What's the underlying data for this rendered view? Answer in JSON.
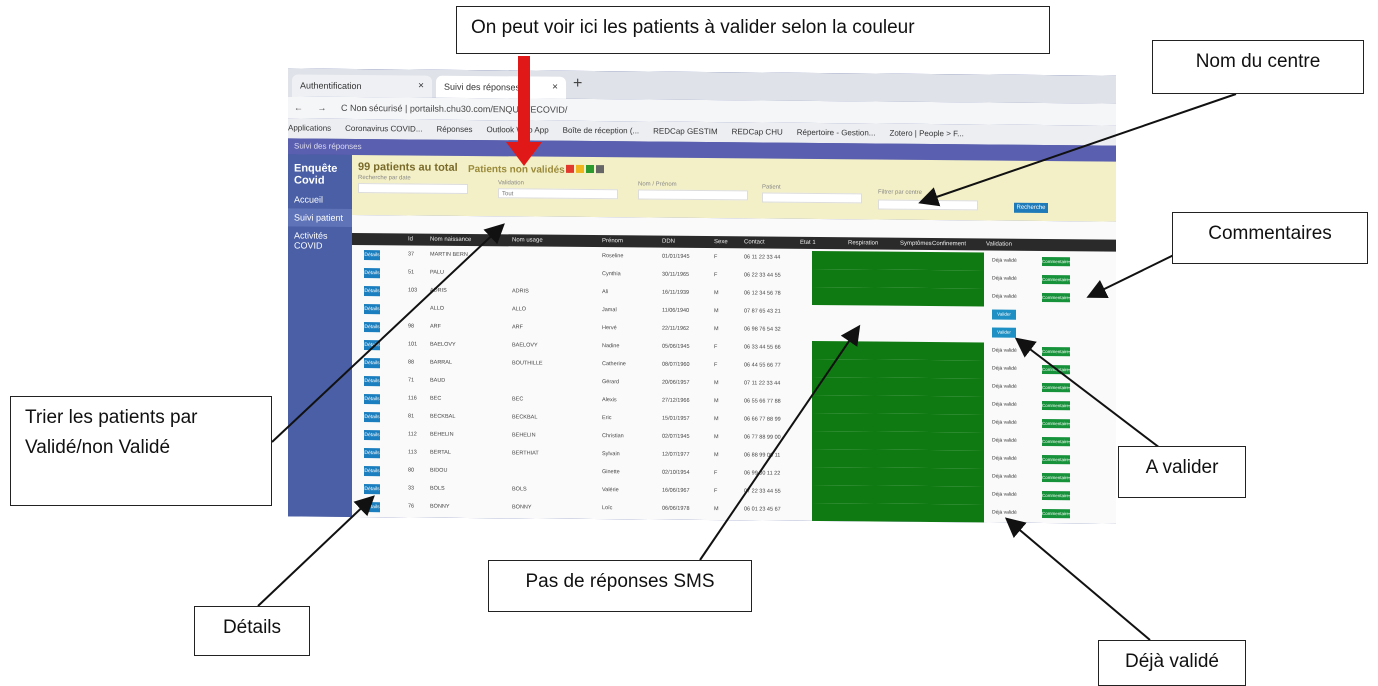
{
  "callouts": {
    "patients_couleur": "On peut voir ici les patients à valider selon la couleur",
    "nom_centre": "Nom du centre",
    "commentaires": "Commentaires",
    "trier_line1": "Trier les patients par",
    "trier_line2": "Validé/non Validé",
    "a_valider": "A valider",
    "pas_sms": "Pas de réponses SMS",
    "details": "Détails",
    "deja_valide": "Déjà validé"
  },
  "browser": {
    "tab1": "Authentification",
    "tab2": "Suivi des réponses",
    "close": "×",
    "new_tab": "+",
    "nav": "← → C ⌂",
    "url": "Non sécurisé | portailsh.chu30.com/ENQUETECOVID/",
    "bookmarks": [
      "Applications",
      "Coronavirus COVID...",
      "Réponses",
      "Outlook Web App",
      "Boîte de réception (...",
      "REDCap GESTIM",
      "REDCap CHU",
      "Répertoire - Gestion...",
      "Zotero | People > F..."
    ]
  },
  "app": {
    "topbar": "Suivi des réponses",
    "brand": "Enquête Covid",
    "side_items": [
      "Accueil",
      "Suivi patient",
      "Activités COVID"
    ],
    "total": "99 patients au total",
    "non_valides": "Patients non validés :",
    "status_colors": [
      "#e23b2e",
      "#f0b41c",
      "#2c9a2c",
      "#666666"
    ],
    "filter_labels": [
      "Recherche par date",
      "Validation",
      "Nom / Prénom",
      "Patient",
      "Filtrer par centre"
    ],
    "filter_value": "Tout",
    "search_button": "Recherche",
    "columns": [
      "Id",
      "Nom naissance",
      "Nom usage",
      "Prénom",
      "DDN",
      "Sexe",
      "Contact",
      "Etat 1",
      "Respiration",
      "Symptômes",
      "Confinement",
      "Validation"
    ]
  },
  "rows": [
    {
      "id": "37",
      "nom": "MARTIN BERN",
      "usage": "",
      "prenom": "Roseline",
      "ddn": "01/01/1945",
      "sexe": "F",
      "contact": "06 11 22 33 44",
      "green": true,
      "validation": "Déjà validé",
      "comment": true
    },
    {
      "id": "51",
      "nom": "PALU",
      "usage": "",
      "prenom": "Cynthia",
      "ddn": "30/11/1965",
      "sexe": "F",
      "contact": "06 22 33 44 55",
      "green": true,
      "validation": "Déjà validé",
      "comment": true
    },
    {
      "id": "103",
      "nom": "ADRIS",
      "usage": "ADRIS",
      "prenom": "Ali",
      "ddn": "16/11/1939",
      "sexe": "M",
      "contact": "06 12 34 56 78",
      "green": true,
      "validation": "Déjà validé",
      "comment": true
    },
    {
      "id": "",
      "nom": "ALLO",
      "usage": "ALLO",
      "prenom": "Jamal",
      "ddn": "11/06/1940",
      "sexe": "M",
      "contact": "07 87 65 43 21",
      "green": false,
      "validation": "Valider",
      "comment": false
    },
    {
      "id": "98",
      "nom": "ARF",
      "usage": "ARF",
      "prenom": "Hervé",
      "ddn": "22/11/1962",
      "sexe": "M",
      "contact": "06 98 76 54 32",
      "green": false,
      "validation": "Valider",
      "comment": false
    },
    {
      "id": "101",
      "nom": "BAELOVY",
      "usage": "BAELOVY",
      "prenom": "Nadine",
      "ddn": "05/06/1945",
      "sexe": "F",
      "contact": "06 33 44 55 66",
      "green": true,
      "validation": "Déjà validé",
      "comment": true
    },
    {
      "id": "88",
      "nom": "BARRAL",
      "usage": "BOUTHILLE",
      "prenom": "Catherine",
      "ddn": "08/07/1960",
      "sexe": "F",
      "contact": "06 44 55 66 77",
      "green": true,
      "validation": "Déjà validé",
      "comment": true
    },
    {
      "id": "71",
      "nom": "BAUD",
      "usage": "",
      "prenom": "Gérard",
      "ddn": "20/06/1957",
      "sexe": "M",
      "contact": "07 11 22 33 44",
      "green": true,
      "validation": "Déjà validé",
      "comment": true
    },
    {
      "id": "116",
      "nom": "BEC",
      "usage": "BEC",
      "prenom": "Alexis",
      "ddn": "27/12/1966",
      "sexe": "M",
      "contact": "06 55 66 77 88",
      "green": true,
      "validation": "Déjà validé",
      "comment": true
    },
    {
      "id": "81",
      "nom": "BECKBAL",
      "usage": "BECKBAL",
      "prenom": "Eric",
      "ddn": "15/01/1957",
      "sexe": "M",
      "contact": "06 66 77 88 99",
      "green": true,
      "validation": "Déjà validé",
      "comment": true
    },
    {
      "id": "112",
      "nom": "BEHELIN",
      "usage": "BEHELIN",
      "prenom": "Christian",
      "ddn": "02/07/1945",
      "sexe": "M",
      "contact": "06 77 88 99 00",
      "green": true,
      "validation": "Déjà validé",
      "comment": true
    },
    {
      "id": "113",
      "nom": "BERTAL",
      "usage": "BERTHIAT",
      "prenom": "Sylvain",
      "ddn": "12/07/1977",
      "sexe": "M",
      "contact": "06 88 99 00 11",
      "green": true,
      "validation": "Déjà validé",
      "comment": true
    },
    {
      "id": "80",
      "nom": "BIDOU",
      "usage": "",
      "prenom": "Ginette",
      "ddn": "02/10/1954",
      "sexe": "F",
      "contact": "06 99 00 11 22",
      "green": true,
      "validation": "Déjà validé",
      "comment": true
    },
    {
      "id": "33",
      "nom": "BOLS",
      "usage": "BOLS",
      "prenom": "Valérie",
      "ddn": "16/06/1967",
      "sexe": "F",
      "contact": "07 22 33 44 55",
      "green": true,
      "validation": "Déjà validé",
      "comment": true
    },
    {
      "id": "76",
      "nom": "BONNY",
      "usage": "BONNY",
      "prenom": "Loïc",
      "ddn": "06/06/1978",
      "sexe": "M",
      "contact": "06 01 23 45 67",
      "green": true,
      "validation": "Déjà validé",
      "comment": true
    }
  ],
  "labels": {
    "details": "Détails",
    "commentaires": "Commentaires"
  }
}
